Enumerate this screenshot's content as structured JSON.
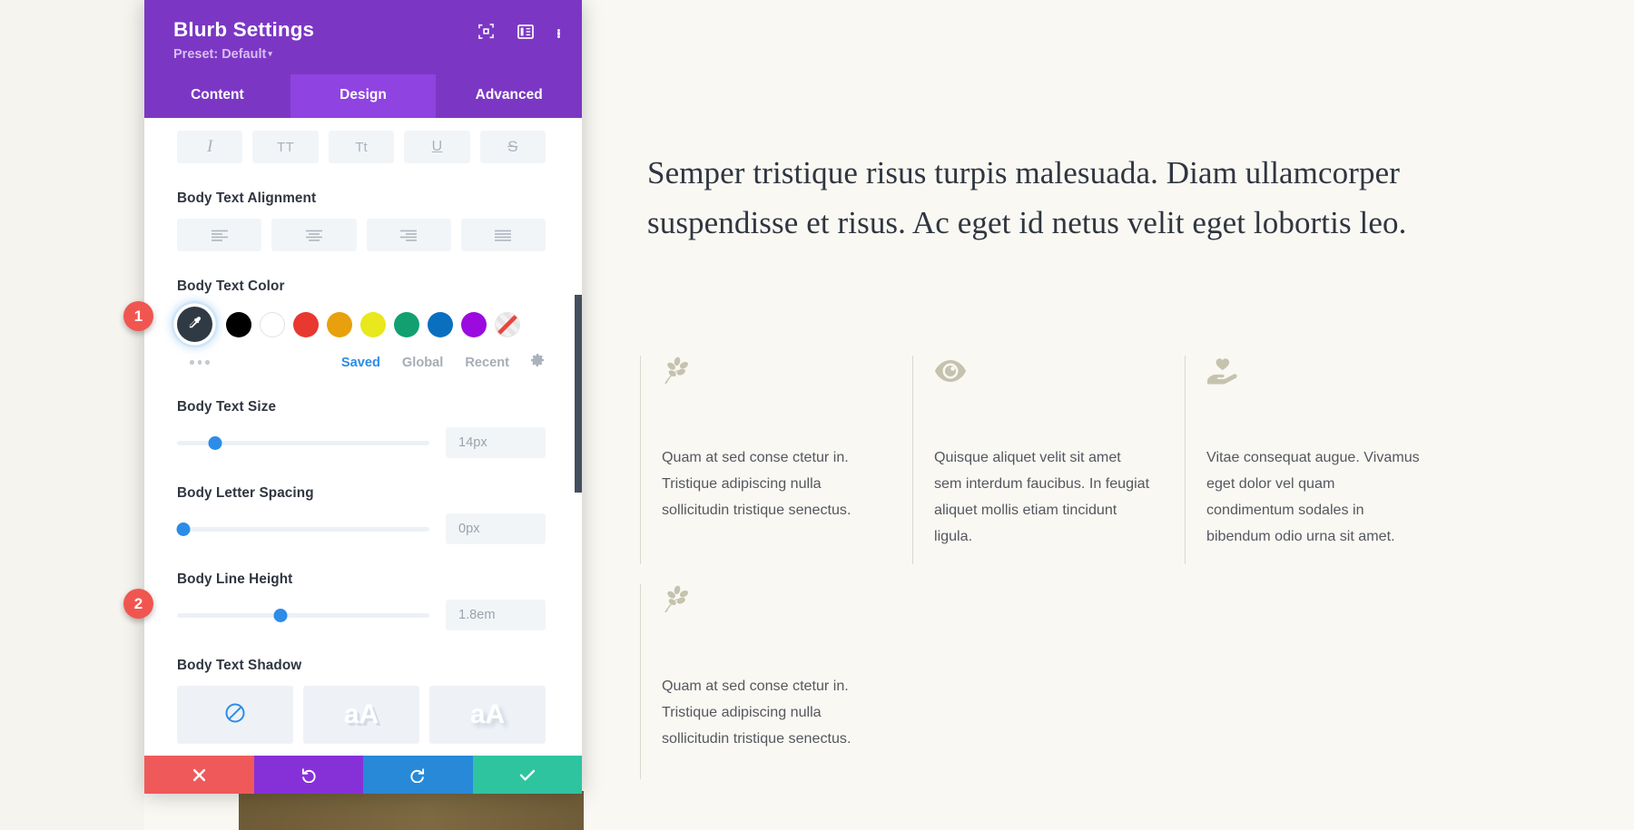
{
  "modal": {
    "title": "Blurb Settings",
    "preset_label": "Preset: Default",
    "header_icons": [
      {
        "name": "focus-icon",
        "glyph": "focus"
      },
      {
        "name": "layout-toggle-icon",
        "glyph": "layout"
      },
      {
        "name": "more-options-icon",
        "glyph": "kebab"
      }
    ],
    "tabs": [
      {
        "label": "Content",
        "active": false
      },
      {
        "label": "Design",
        "active": true
      },
      {
        "label": "Advanced",
        "active": false
      }
    ],
    "format_buttons": [
      {
        "name": "italic-button",
        "glyph": "I"
      },
      {
        "name": "uppercase-button",
        "glyph": "TT"
      },
      {
        "name": "smallcaps-button",
        "glyph": "Tt"
      },
      {
        "name": "underline-button",
        "glyph": "U"
      },
      {
        "name": "strikethrough-button",
        "glyph": "S"
      }
    ],
    "alignment": {
      "label": "Body Text Alignment",
      "options": [
        "align-left",
        "align-center",
        "align-right",
        "align-justify"
      ]
    },
    "text_color": {
      "label": "Body Text Color",
      "eyedropper_name": "color-picker-eyedropper",
      "swatches": [
        {
          "name": "swatch-black",
          "color": "#000000"
        },
        {
          "name": "swatch-white",
          "color": "#ffffff"
        },
        {
          "name": "swatch-red",
          "color": "#e8382f"
        },
        {
          "name": "swatch-orange",
          "color": "#e8a00c"
        },
        {
          "name": "swatch-yellow",
          "color": "#e8e81c"
        },
        {
          "name": "swatch-green",
          "color": "#12a071"
        },
        {
          "name": "swatch-blue",
          "color": "#0b6fc0"
        },
        {
          "name": "swatch-purple",
          "color": "#9b0be0"
        },
        {
          "name": "swatch-none",
          "color": "transparent"
        }
      ],
      "meta_tabs": [
        {
          "label": "Saved",
          "active": true
        },
        {
          "label": "Global",
          "active": false
        },
        {
          "label": "Recent",
          "active": false
        }
      ],
      "settings_icon": "gear-icon"
    },
    "text_size": {
      "label": "Body Text Size",
      "value": "14px",
      "knob_percent": 15
    },
    "letter_spacing": {
      "label": "Body Letter Spacing",
      "value": "0px",
      "knob_percent": 2
    },
    "line_height": {
      "label": "Body Line Height",
      "value": "1.8em",
      "knob_percent": 41
    },
    "text_shadow": {
      "label": "Body Text Shadow",
      "options": [
        {
          "name": "shadow-none",
          "glyph": "none"
        },
        {
          "name": "shadow-hard",
          "glyph": "aA"
        },
        {
          "name": "shadow-soft",
          "glyph": "aA"
        }
      ]
    },
    "footer": [
      {
        "name": "cancel-button",
        "glyph": "✖",
        "color": "#f0595a"
      },
      {
        "name": "undo-button",
        "glyph": "↺",
        "color": "#8631d8"
      },
      {
        "name": "redo-button",
        "glyph": "↻",
        "color": "#2789d8"
      },
      {
        "name": "save-button",
        "glyph": "✔",
        "color": "#2ec4a0"
      }
    ]
  },
  "badges": [
    {
      "label": "1"
    },
    {
      "label": "2"
    }
  ],
  "page": {
    "heading": "Semper tristique risus turpis malesuada. Diam ullamcorper suspendisse et risus. Ac eget id netus velit eget lobortis leo.",
    "blurbs": [
      {
        "icon": "leaf-branch-icon",
        "text": "Quam at sed conse ctetur in. Tristique adipiscing nulla sollicitudin tristique senectus."
      },
      {
        "icon": "eye-icon",
        "text": "Quisque aliquet velit sit amet sem interdum faucibus. In feugiat aliquet mollis etiam tincidunt ligula."
      },
      {
        "icon": "heart-in-hand-icon",
        "text": "Vitae consequat augue. Vivamus eget dolor vel quam condimentum sodales in bibendum odio urna sit amet."
      },
      {
        "icon": "leaf-branch-icon",
        "text": "Quam at sed conse ctetur in. Tristique adipiscing nulla sollicitudin tristique senectus."
      }
    ]
  }
}
